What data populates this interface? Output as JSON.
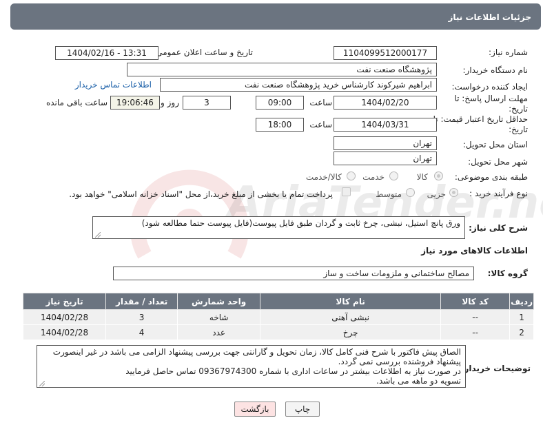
{
  "header": {
    "title": "جزئیات اطلاعات نیاز"
  },
  "form": {
    "need_number_label": "شماره نیاز:",
    "need_number": "1104099512000177",
    "announce_label": "تاریخ و ساعت اعلان عمومی:",
    "announce_value": "1404/02/16 - 13:31",
    "buyer_org_label": "نام دستگاه خریدار:",
    "buyer_org": "پژوهشگاه صنعت نفت",
    "requester_label": "ایجاد کننده درخواست:",
    "requester": "ابراهیم شیرکوند کارشناس خرید پژوهشگاه صنعت نفت",
    "contact_link": "اطلاعات تماس خریدار",
    "reply_deadline_label": "مهلت ارسال پاسخ: تا تاریخ:",
    "reply_date": "1404/02/20",
    "time_word": "ساعت",
    "reply_time": "09:00",
    "days_value": "3",
    "days_word": "روز و",
    "remaining_time": "19:06:46",
    "remaining_word": "ساعت باقی مانده",
    "price_validity_label": "حداقل تاریخ اعتبار قیمت: تا تاریخ:",
    "price_date": "1404/03/31",
    "price_time": "18:00",
    "province_label": "استان محل تحویل:",
    "province": "تهران",
    "city_label": "شهر محل تحویل:",
    "city": "تهران",
    "category_label": "طبقه بندی موضوعی:",
    "category_options": [
      "کالا",
      "خدمت",
      "کالا/خدمت"
    ],
    "process_label": "نوع فرآیند خرید :",
    "process_options": [
      "جزیی",
      "متوسط"
    ],
    "payment_note": "پرداخت تمام یا بخشی از مبلغ خرید،از محل \"اسناد خزانه اسلامی\" خواهد بود.",
    "summary_label": "شرح کلی نیاز:",
    "summary": "ورق پانچ استیل، نبشی، چرخ ثابت و گردان طبق فایل پیوست(فایل پیوست حتما مطالعه شود)"
  },
  "goods": {
    "section_title": "اطلاعات کالاهای مورد نیاز",
    "group_label": "گروه کالا:",
    "group_value": "مصالح ساختمانی و ملزومات ساخت و ساز",
    "columns": [
      "ردیف",
      "کد کالا",
      "نام کالا",
      "واحد شمارش",
      "تعداد / مقدار",
      "تاریخ نیاز"
    ],
    "rows": [
      [
        "1",
        "--",
        "نبشی آهنی",
        "شاخه",
        "3",
        "1404/02/28"
      ],
      [
        "2",
        "--",
        "چرخ",
        "عدد",
        "4",
        "1404/02/28"
      ]
    ]
  },
  "buyer_notes": {
    "label": "توضیحات خریدار:",
    "lines": [
      "الصاق پیش فاکتور با شرح فنی کامل کالا، زمان تحویل و گارانتی جهت بررسی پیشنهاد الزامی می باشد در غیر اینصورت",
      "پیشنهاد فروشنده بررسی نمی گردد.",
      "در صورت نیاز به اطلاعات بیشتر در ساعات اداری با شماره 09367974300 تماس حاصل فرمایید",
      "تسویه دو ماهه می باشد."
    ]
  },
  "buttons": {
    "print": "چاپ",
    "back": "بازگشت"
  },
  "watermark": {
    "text": "AriaTender.net"
  },
  "colors": {
    "header_bg": "#6b7480",
    "link": "#1a5fa8",
    "back_button_bg": "#fde3e3"
  }
}
